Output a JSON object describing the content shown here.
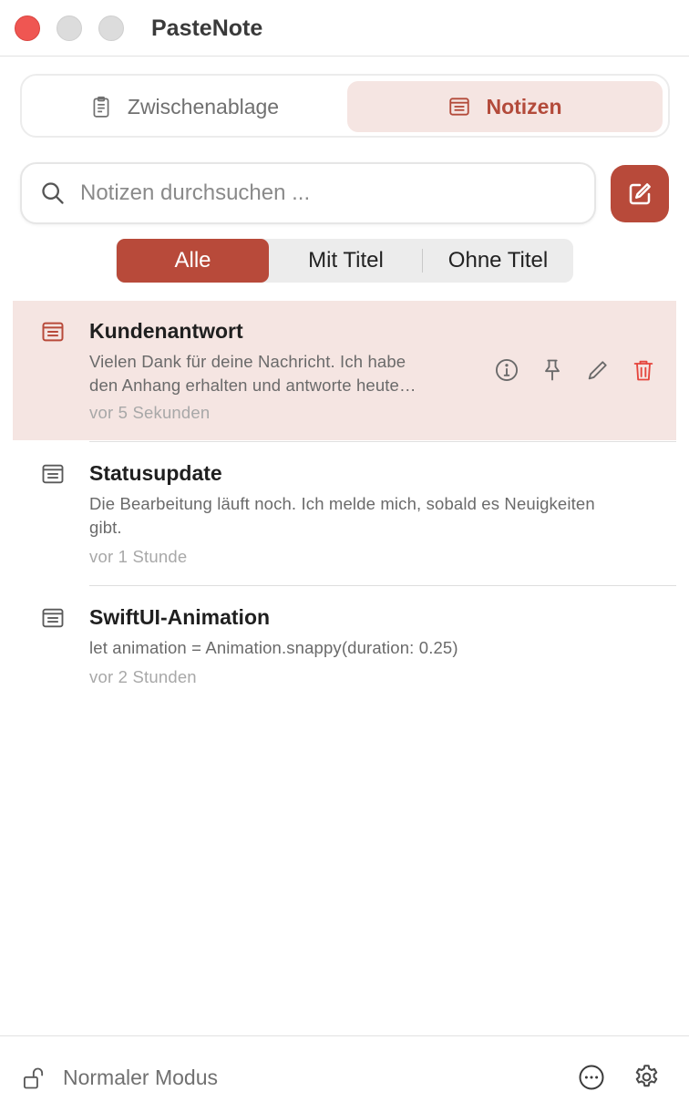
{
  "app": {
    "title": "PasteNote"
  },
  "tabs": [
    {
      "label": "Zwischenablage",
      "icon": "clipboard-icon",
      "active": false
    },
    {
      "label": "Notizen",
      "icon": "note-icon",
      "active": true
    }
  ],
  "search": {
    "placeholder": "Notizen durchsuchen ...",
    "value": ""
  },
  "filter": {
    "all": "Alle",
    "with_title": "Mit Titel",
    "without_title": "Ohne Titel",
    "selected": "Alle"
  },
  "notes": [
    {
      "title": "Kundenantwort",
      "body_line1": "Vielen Dank für deine Nachricht. Ich habe",
      "body_line2": "den Anhang erhalten und antworte heute…",
      "time": "vor 5 Sekunden",
      "selected": true
    },
    {
      "title": "Statusupdate",
      "body_line1": "Die Bearbeitung läuft noch. Ich melde mich, sobald es Neuigkeiten",
      "body_line2": "gibt.",
      "time": "vor 1 Stunde",
      "selected": false
    },
    {
      "title": "SwiftUI-Animation",
      "body_line1": "let animation = Animation.snappy(duration: 0.25)",
      "time": "vor 2 Stunden",
      "selected": false
    }
  ],
  "footer": {
    "mode": "Normaler Modus"
  },
  "colors": {
    "accent": "#b84a3a",
    "accent_light": "#f5e5e2",
    "delete": "#e5453d",
    "close_button": "#ef5652"
  }
}
